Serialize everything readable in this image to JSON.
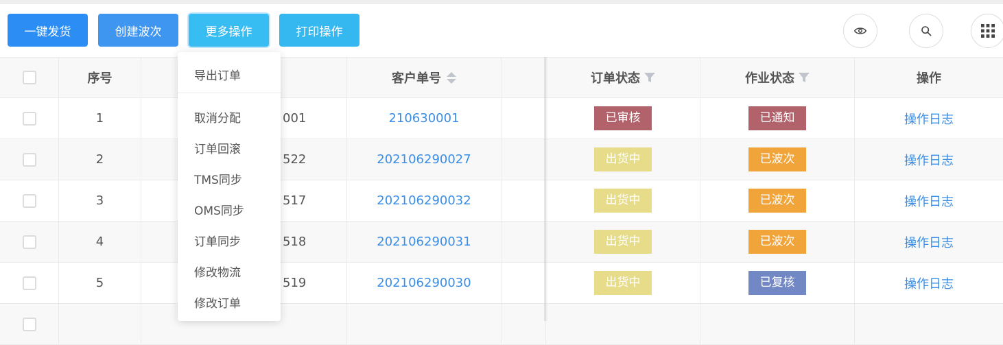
{
  "toolbar": {
    "buttons": [
      "一键发货",
      "创建波次",
      "更多操作",
      "打印操作"
    ]
  },
  "icons": {
    "view": "eye-icon",
    "search": "search-icon",
    "columns": "grid-icon"
  },
  "more_menu": {
    "items": [
      "导出订单",
      "取消分配",
      "订单回滚",
      "TMS同步",
      "OMS同步",
      "订单同步",
      "修改物流",
      "修改订单"
    ]
  },
  "table": {
    "headers": {
      "index": "序号",
      "customer_no": "客户单号",
      "order_status": "订单状态",
      "work_status": "作业状态",
      "action": "操作"
    },
    "rows": [
      {
        "index": "1",
        "order_no_suffix": "001",
        "customer_no": "210630001",
        "order_status": "已审核",
        "work_status": "已通知",
        "action": "操作日志"
      },
      {
        "index": "2",
        "order_no_suffix": "522",
        "customer_no": "202106290027",
        "order_status": "出货中",
        "work_status": "已波次",
        "action": "操作日志"
      },
      {
        "index": "3",
        "order_no_suffix": "517",
        "customer_no": "202106290032",
        "order_status": "出货中",
        "work_status": "已波次",
        "action": "操作日志"
      },
      {
        "index": "4",
        "order_no_suffix": "518",
        "customer_no": "202106290031",
        "order_status": "出货中",
        "work_status": "已波次",
        "action": "操作日志"
      },
      {
        "index": "5",
        "order_no_suffix": "519",
        "customer_no": "202106290030",
        "order_status": "出货中",
        "work_status": "已复核",
        "action": "操作日志"
      }
    ]
  },
  "colors": {
    "primary": "#2c8ef5",
    "link": "#3a8ee6",
    "status_reviewed": "#b2626a",
    "status_notified": "#b2626a",
    "status_shipping": "#e6dc8a",
    "status_waved": "#f0a43a",
    "status_rechecked": "#7188c4"
  }
}
